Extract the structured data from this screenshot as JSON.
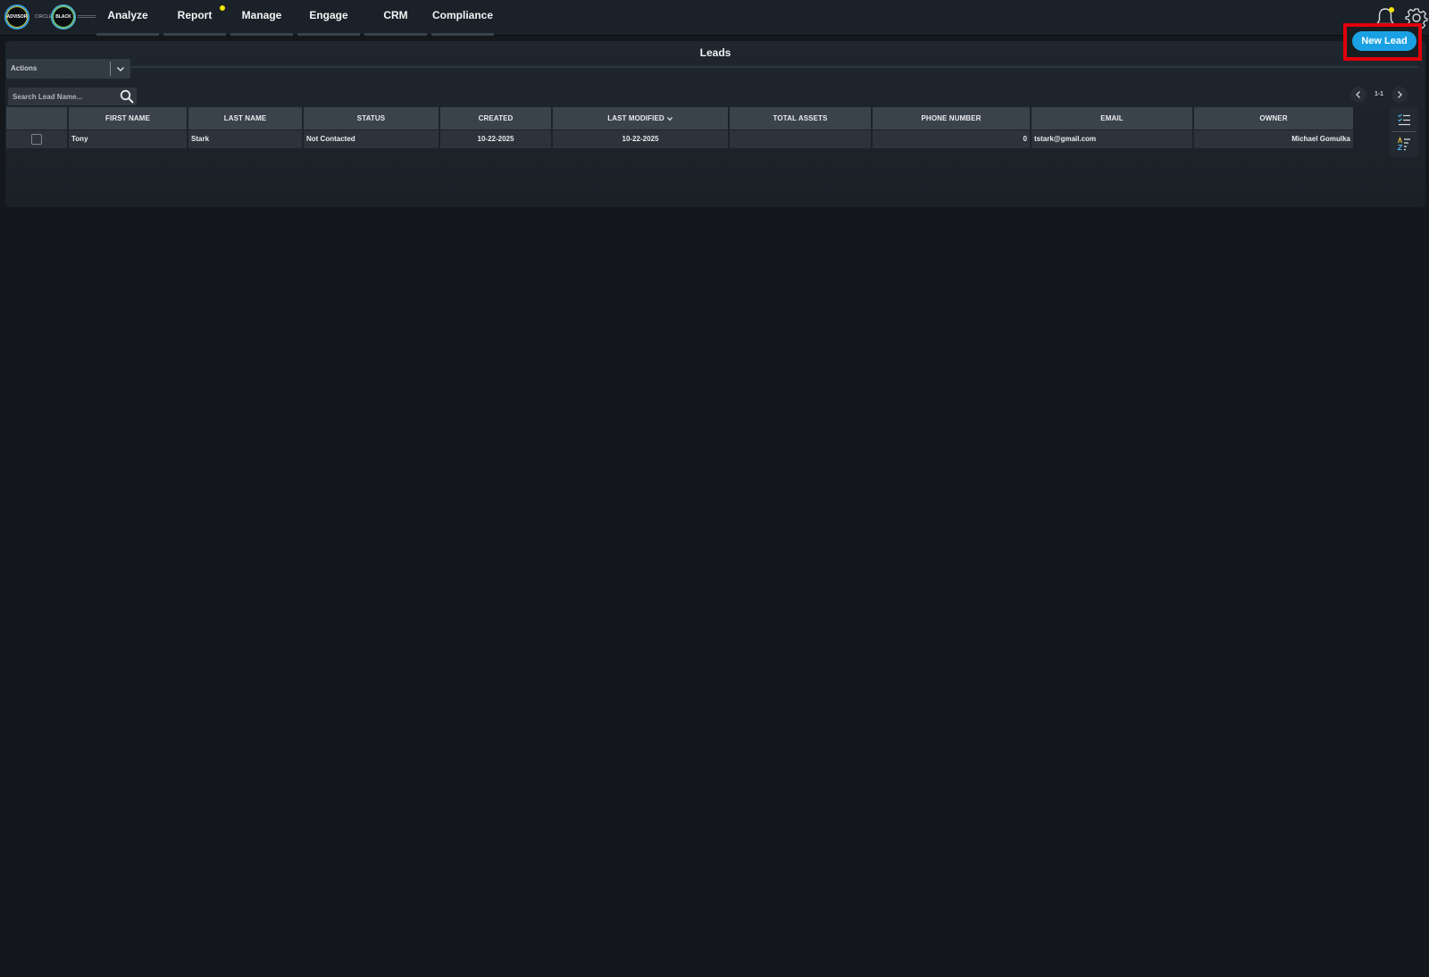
{
  "logo": {
    "left_text": "ADVISOR",
    "middle_text": "CIRCLE",
    "right_text": "BLACK"
  },
  "nav": [
    {
      "label": "Analyze"
    },
    {
      "label": "Report"
    },
    {
      "label": "Manage"
    },
    {
      "label": "Engage"
    },
    {
      "label": "CRM"
    },
    {
      "label": "Compliance"
    }
  ],
  "header_icons": [
    "bell-icon",
    "gear-icon"
  ],
  "page": {
    "title": "Leads"
  },
  "toolbar": {
    "new_lead_label": "New Lead",
    "actions_label": "Actions",
    "search_placeholder": "Search Lead Name...",
    "pager_label": "1-1"
  },
  "table": {
    "headers": [
      "FIRST NAME",
      "LAST NAME",
      "STATUS",
      "CREATED",
      "LAST MODIFIED",
      "TOTAL ASSETS",
      "PHONE NUMBER",
      "EMAIL",
      "OWNER"
    ],
    "sorted_column": "LAST MODIFIED",
    "rows": [
      {
        "first_name": "Tony",
        "last_name": "Stark",
        "status": "Not Contacted",
        "created": "10-22-2025",
        "last_modified": "10-22-2025",
        "total_assets": "",
        "phone_number": "0",
        "email": "tstark@gmail.com",
        "owner": "Michael Gomulka"
      }
    ]
  },
  "colors": {
    "background": "#14181c",
    "topbar": "#1b2128",
    "accent_button": "#1aa1e4",
    "highlight_frame": "#e0000b",
    "notification_dot": "#f2e500"
  }
}
